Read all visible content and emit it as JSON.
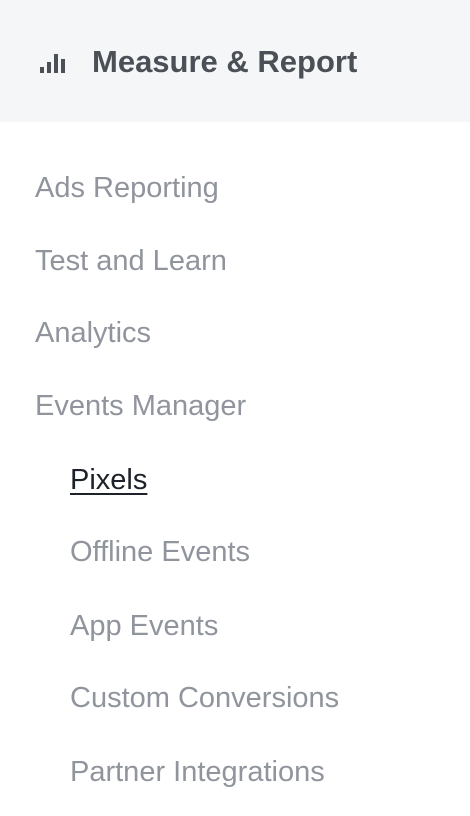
{
  "header": {
    "icon": "bar-chart-icon",
    "title": "Measure & Report"
  },
  "nav": {
    "items": [
      {
        "label": "Ads Reporting"
      },
      {
        "label": "Test and Learn"
      },
      {
        "label": "Analytics"
      },
      {
        "label": "Events Manager"
      }
    ],
    "subitems": [
      {
        "label": "Pixels",
        "active": true
      },
      {
        "label": "Offline Events"
      },
      {
        "label": "App Events"
      },
      {
        "label": "Custom Conversions"
      },
      {
        "label": "Partner Integrations"
      }
    ]
  },
  "colors": {
    "header_bg": "#f5f6f7",
    "title": "#4b4f56",
    "item_text": "#90949c",
    "active_text": "#1d2129"
  }
}
